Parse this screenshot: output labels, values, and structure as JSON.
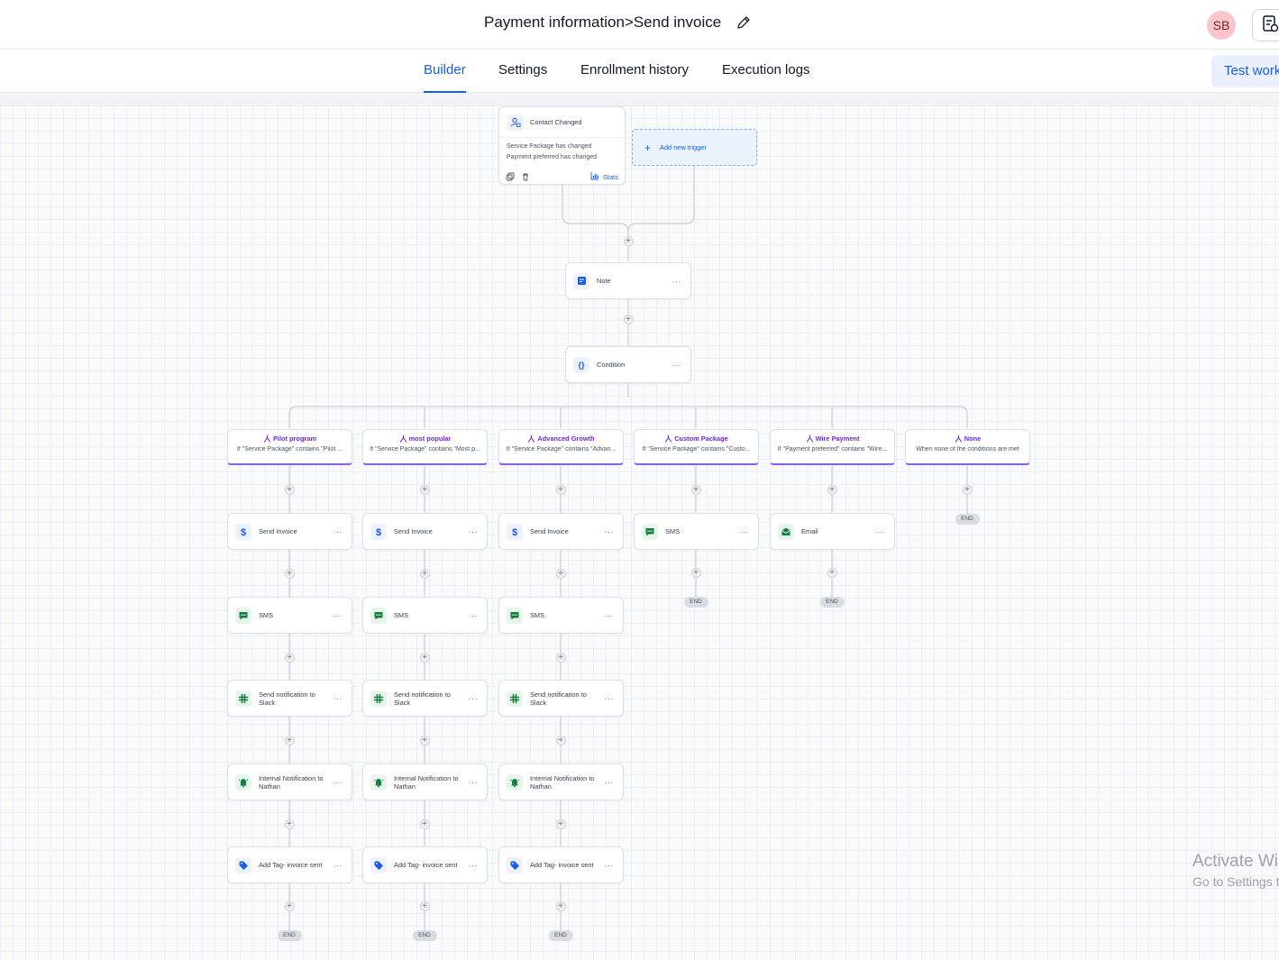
{
  "header": {
    "breadcrumb_parent": "Payment information",
    "breadcrumb_sep": ">",
    "breadcrumb_current": "Send invoice",
    "avatar_initials": "SB"
  },
  "tabs": {
    "builder": "Builder",
    "settings": "Settings",
    "enrollment": "Enrollment history",
    "logs": "Execution logs",
    "active": "Builder"
  },
  "test_button": "Test workflow",
  "trigger": {
    "title": "Contact Changed",
    "conditions": [
      "Service Package has changed",
      "Payment preferred has changed"
    ],
    "stats_label": "Stats",
    "add_trigger_label": "Add new trigger"
  },
  "note_label": "Note",
  "condition_label": "Condition",
  "branches": [
    {
      "title": "Pilot program",
      "desc": "If \"Service Package\" contains \"Pilot ...",
      "steps": [
        {
          "label": "Send Invoice",
          "icon": "dollar-icon"
        },
        {
          "label": "SMS",
          "icon": "sms-icon"
        },
        {
          "label": "Send notification to Slack",
          "icon": "slack-icon"
        },
        {
          "label": "Internal Notification to Nathan",
          "icon": "bell-icon"
        },
        {
          "label": "Add Tag- invoice sent",
          "icon": "tag-icon"
        }
      ]
    },
    {
      "title": "most popular",
      "desc": "If \"Service Package\" contains \"Most p...",
      "steps": [
        {
          "label": "Send Invoice",
          "icon": "dollar-icon"
        },
        {
          "label": "SMS",
          "icon": "sms-icon"
        },
        {
          "label": "Send notification to Slack",
          "icon": "slack-icon"
        },
        {
          "label": "Internal Notification to Nathan",
          "icon": "bell-icon"
        },
        {
          "label": "Add Tag- invoice sent",
          "icon": "tag-icon"
        }
      ]
    },
    {
      "title": "Advanced Growth",
      "desc": "If \"Service Package\" contains \"Advan...",
      "steps": [
        {
          "label": "Send Invoice",
          "icon": "dollar-icon"
        },
        {
          "label": "SMS",
          "icon": "sms-icon"
        },
        {
          "label": "Send notification to Slack",
          "icon": "slack-icon"
        },
        {
          "label": "Internal Notification to Nathan",
          "icon": "bell-icon"
        },
        {
          "label": "Add Tag- invoice sent",
          "icon": "tag-icon"
        }
      ]
    },
    {
      "title": "Custom Package",
      "desc": "If \"Service Package\" contains \"Custo...",
      "steps": [
        {
          "label": "SMS",
          "icon": "sms-icon"
        }
      ]
    },
    {
      "title": "Wire Payment",
      "desc": "If \"Payment preferred\" contains \"Wire...",
      "steps": [
        {
          "label": "Email",
          "icon": "email-icon"
        }
      ]
    },
    {
      "title": "None",
      "desc": "When none of the conditions are met",
      "steps": []
    }
  ],
  "end_label": "END",
  "watermark": {
    "line1": "Activate Windows",
    "line2": "Go to Settings to activate Windows."
  },
  "colors": {
    "accent": "#155eef",
    "branch": "#8b5cf6",
    "slack_green": "#15803d"
  }
}
